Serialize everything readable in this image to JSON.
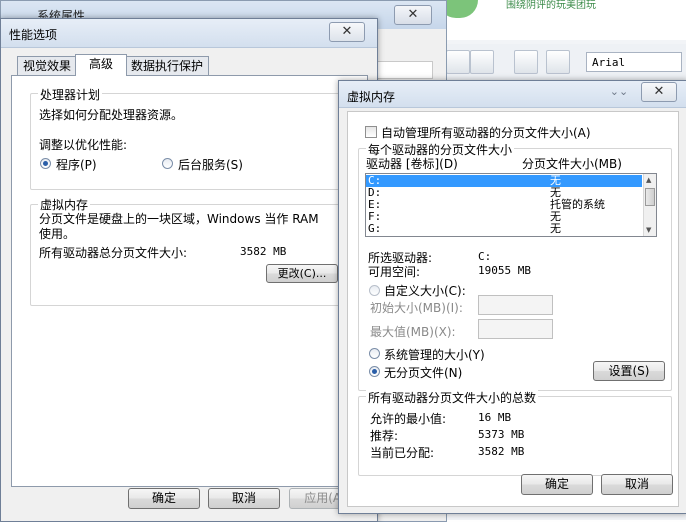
{
  "background_app": {
    "banner_text": "围绕阴评的玩美团玩",
    "font_value": "Arial"
  },
  "system_properties": {
    "title": "系统属性",
    "close_icon": "close-icon"
  },
  "performance_options": {
    "title": "性能选项",
    "tabs": [
      "视觉效果",
      "高级",
      "数据执行保护"
    ],
    "active_tab": "高级",
    "processor": {
      "group_title": "处理器计划",
      "description": "选择如何分配处理器资源。",
      "optimize_label": "调整以优化性能:",
      "radio_programs": "程序(P)",
      "radio_services": "后台服务(S)",
      "selected": "程序(P)"
    },
    "virtual_memory": {
      "group_title": "虚拟内存",
      "description": "分页文件是硬盘上的一块区域，Windows 当作 RAM 使用。",
      "total_label": "所有驱动器总分页文件大小:",
      "total_value": "3582 MB",
      "change_button": "更改(C)..."
    },
    "buttons": {
      "ok": "确定",
      "cancel": "取消",
      "apply": "应用(A)"
    }
  },
  "virtual_memory_dialog": {
    "title": "虚拟内存",
    "auto_manage_label": "自动管理所有驱动器的分页文件大小(A)",
    "auto_manage_checked": false,
    "per_drive_title": "每个驱动器的分页文件大小",
    "col_drive": "驱动器 [卷标](D)",
    "col_size": "分页文件大小(MB)",
    "drives": [
      {
        "drive": "C:",
        "size": "无",
        "selected": true
      },
      {
        "drive": "D:",
        "size": "无",
        "selected": false
      },
      {
        "drive": "E:",
        "size": "托管的系统",
        "selected": false
      },
      {
        "drive": "F:",
        "size": "无",
        "selected": false
      },
      {
        "drive": "G:",
        "size": "无",
        "selected": false
      }
    ],
    "selected_drive_label": "所选驱动器:",
    "selected_drive_value": "C:",
    "free_space_label": "可用空间:",
    "free_space_value": "19055 MB",
    "custom_size_label": "自定义大小(C):",
    "initial_size_label": "初始大小(MB)(I):",
    "max_size_label": "最大值(MB)(X):",
    "system_managed_label": "系统管理的大小(Y)",
    "no_paging_label": "无分页文件(N)",
    "selected_option": "无分页文件(N)",
    "set_button": "设置(S)",
    "totals_title": "所有驱动器分页文件大小的总数",
    "min_label": "允许的最小值:",
    "min_value": "16 MB",
    "recommended_label": "推荐:",
    "recommended_value": "5373 MB",
    "current_label": "当前已分配:",
    "current_value": "3582 MB",
    "buttons": {
      "ok": "确定",
      "cancel": "取消"
    }
  }
}
